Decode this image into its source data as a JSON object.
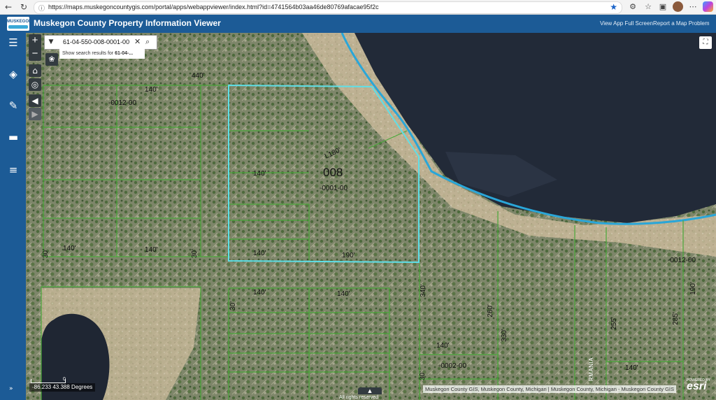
{
  "browser": {
    "url": "https://maps.muskegoncountygis.com/portal/apps/webappviewer/index.html?id=4741564b03aa46de80769afacae95f2c"
  },
  "header": {
    "logo_text": "MUSKEGON",
    "title": "Muskegon County Property Information Viewer",
    "links": [
      "View App Full Screen",
      "Report a Map Problem"
    ]
  },
  "search": {
    "value": "61-04-550-008-0001-00",
    "suggestion_prefix": "Show search results for ",
    "suggestion_bold": "61-04-..."
  },
  "map": {
    "parcel_number": "008",
    "parcel_labels": [
      "-0012-00",
      "-0001-00",
      "-0012-00",
      "-0002-00"
    ],
    "dimension_labels": [
      "440'",
      "140'",
      "140'",
      "140'",
      "140'",
      "190'",
      "30'",
      "140'",
      "30'",
      "140'",
      "140'",
      "30'",
      "340'",
      "260'",
      "330'",
      "140'",
      "30'",
      "140'",
      "255'",
      "285'",
      "190'",
      "L180'"
    ],
    "street_label": "RMANIA",
    "coordinates": "-86.233 43.388 Degrees",
    "scale_label": "0",
    "attribution": "Muskegon County GIS, Muskegon County, Michigan | Muskegon County, Michigan - Muskegon County GIS",
    "powered_by": "POWERED BY",
    "esri": "esri",
    "rights": "All rights reserved",
    "colors": {
      "water": "#222a38",
      "selected_parcel": "#5ee0e8",
      "parcel_lines": "#4aa83a",
      "shoreline": "#2aa6d8"
    }
  }
}
